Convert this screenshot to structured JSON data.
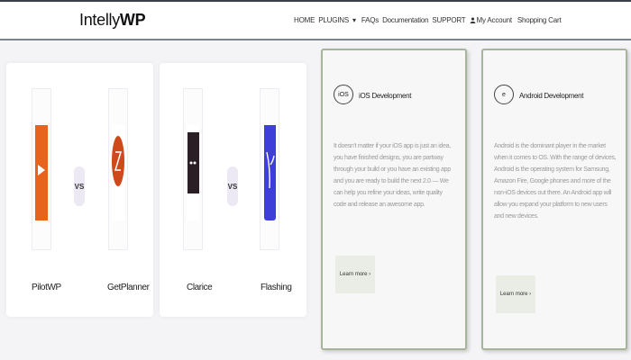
{
  "header": {
    "logo": {
      "prefix": "Intelly",
      "suffix": "WP"
    },
    "nav": {
      "home": "HOME",
      "plugins": "PLUGINS",
      "plugins_caret": "▾",
      "faqs": "FAQs",
      "documentation": "Documentation",
      "support": "SUPPORT",
      "account": "My Account",
      "cart": "Shopping Cart"
    }
  },
  "comparisons": [
    {
      "vs_label": "VS",
      "left": {
        "name": "PilotWP",
        "icon": "pilotwp-logo",
        "color": "#e8641c"
      },
      "right": {
        "name": "GetPlanner",
        "icon": "getplanner-logo",
        "color": "#cf4a1a"
      }
    },
    {
      "vs_label": "VS",
      "left": {
        "name": "Clarice",
        "icon": "clarice-logo",
        "color": "#2a1f24"
      },
      "right": {
        "name": "Flashing",
        "icon": "flashing-logo",
        "color": "#3d3fd8"
      }
    }
  ],
  "services": [
    {
      "icon_label": "iOS",
      "icon": "ios-icon",
      "title": "iOS Development",
      "body": "It doesn't matter if your iOS app is just an idea, you have finished designs, you are partway through your build or you have an existing app and you are ready to build the next 2.0 — We can help you refine your ideas, write quality code and release an awesome app.",
      "button": "Learn more ›"
    },
    {
      "icon_label": "e",
      "icon": "android-icon",
      "title": "Android Development",
      "body": "Android is the dominant player in the market when it comes to OS. With the range of devices, Android is the operating system for Samsung, Amazon Fire, Google phones and more of the non-iOS devices out there. An Android app will allow you expand your platform to new users and new devices.",
      "button": "Learn more ›"
    }
  ],
  "colors": {
    "header_border": "#7e848f",
    "card_border": "#a6b49a",
    "button_bg": "#e9ede6",
    "vs_bg": "#ece8f4"
  }
}
